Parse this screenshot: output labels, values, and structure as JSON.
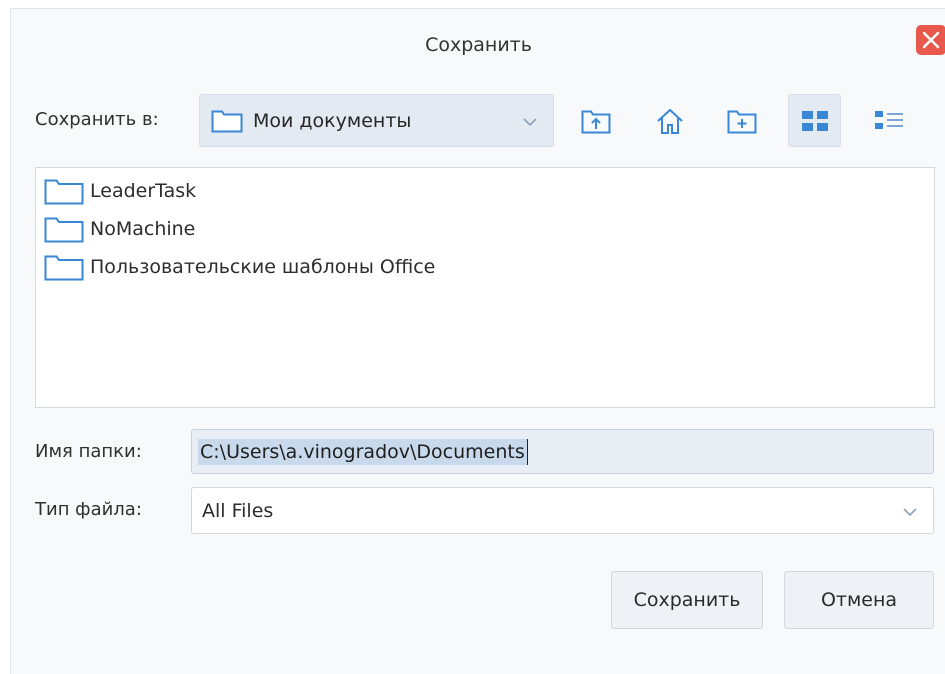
{
  "dialog": {
    "title": "Сохранить",
    "close_icon": "close-icon",
    "accent_color": "#e8584c"
  },
  "toolbar": {
    "save_in_label": "Сохранить в:",
    "location_value": "Мои документы",
    "buttons": [
      {
        "name": "up-folder-button",
        "icon": "folder-up-icon"
      },
      {
        "name": "home-button",
        "icon": "home-icon"
      },
      {
        "name": "new-folder-button",
        "icon": "new-folder-icon"
      },
      {
        "name": "list-view-button",
        "icon": "grid-view-icon",
        "active": true
      },
      {
        "name": "details-view-button",
        "icon": "details-view-icon"
      }
    ]
  },
  "files": [
    {
      "name": "LeaderTask",
      "icon": "folder-icon"
    },
    {
      "name": "NoMachine",
      "icon": "folder-icon"
    },
    {
      "name": "Пользовательские шаблоны Office",
      "icon": "folder-icon"
    }
  ],
  "form": {
    "folder_label": "Имя папки:",
    "folder_value": "C:\\Users\\a.vinogradov\\Documents",
    "type_label": "Тип файла:",
    "type_value": "All Files"
  },
  "actions": {
    "save_label": "Сохранить",
    "cancel_label": "Отмена"
  },
  "colors": {
    "folder_stroke": "#3a87d6",
    "selection": "#c9d9ec"
  }
}
